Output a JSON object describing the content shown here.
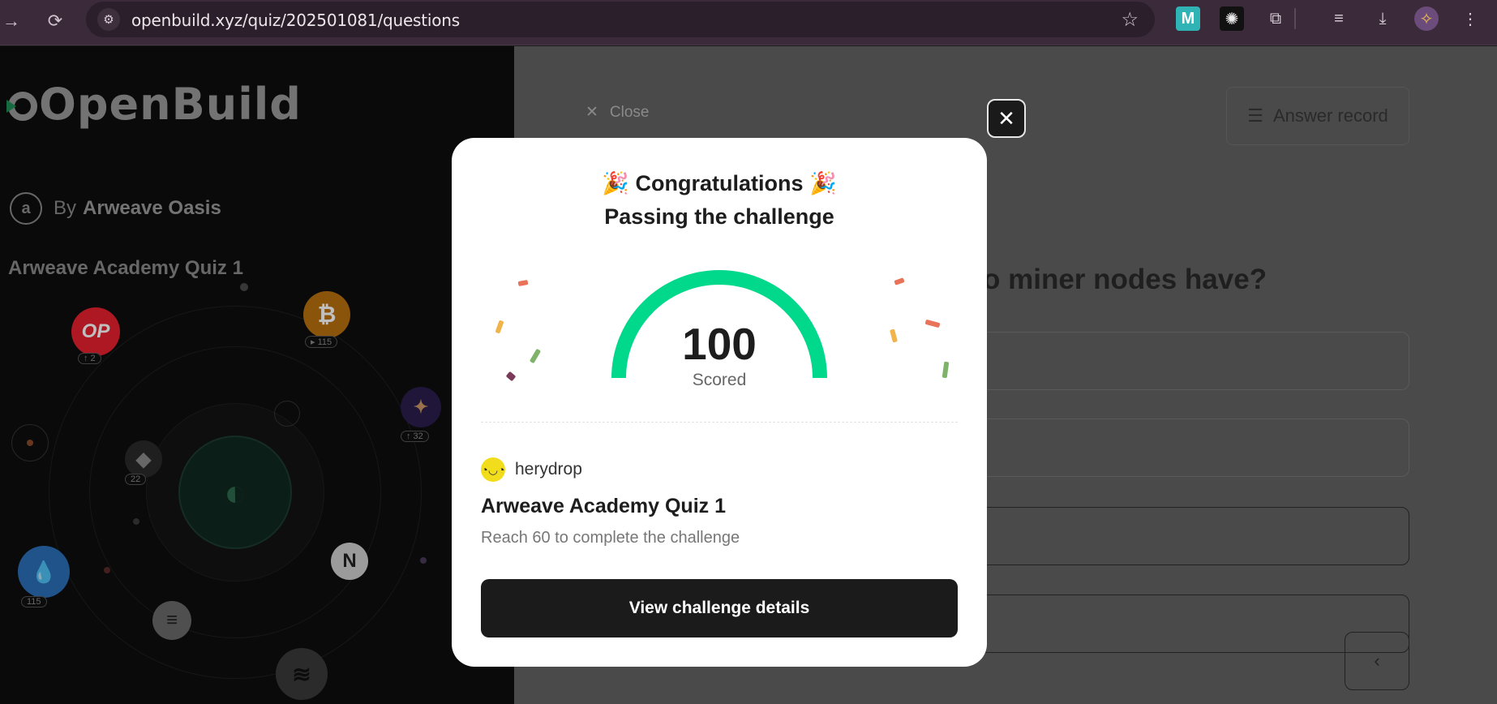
{
  "browser": {
    "url": "openbuild.xyz/quiz/202501081/questions",
    "icons": [
      "back-icon",
      "reload-icon",
      "site-settings-icon",
      "bookmark-star-icon",
      "extension-m-icon",
      "extension-octopus-icon",
      "extensions-puzzle-icon",
      "media-playlist-icon",
      "downloads-icon",
      "profile-avatar-icon",
      "more-menu-icon"
    ]
  },
  "left_panel": {
    "logo": "OpenBuild",
    "by_prefix": "By",
    "by_org": "Arweave Oasis",
    "quiz_title": "Arweave Academy Quiz 1",
    "coins": [
      {
        "name": "op-coin",
        "label": "OP",
        "badge": "↑ 2",
        "color": "#e8202e"
      },
      {
        "name": "bitcoin-coin",
        "label": "₿",
        "badge": "▸ 115",
        "color": "#f7931a"
      },
      {
        "name": "ethereum-coin",
        "label": "◆",
        "badge": "22",
        "color": "#8a8a8a"
      },
      {
        "name": "starknet-coin",
        "label": "✦",
        "badge": "↑ 32",
        "color": "#3b2a6b"
      },
      {
        "name": "sui-coin",
        "label": "💧",
        "badge": "115",
        "color": "#4da2ff"
      },
      {
        "name": "near-coin",
        "label": "N",
        "badge": "",
        "color": "#d9d9d9"
      },
      {
        "name": "solana-coin",
        "label": "≡",
        "badge": "",
        "color": "#cfcfcf"
      }
    ]
  },
  "page": {
    "close_label": "Close",
    "answer_record_label": "Answer record",
    "question_fragment": "o miner nodes have?"
  },
  "modal": {
    "title": "Congratulations",
    "subtitle": "Passing the challenge",
    "score": "100",
    "score_label": "Scored",
    "score_fraction": 1.0,
    "username": "herydrop",
    "quiz_name": "Arweave Academy Quiz 1",
    "requirement": "Reach 60 to complete the challenge",
    "cta_label": "View challenge details"
  },
  "colors": {
    "gauge": "#00d98b",
    "cta_bg": "#1b1b1b",
    "avatar_bg": "#f2dd1c"
  }
}
